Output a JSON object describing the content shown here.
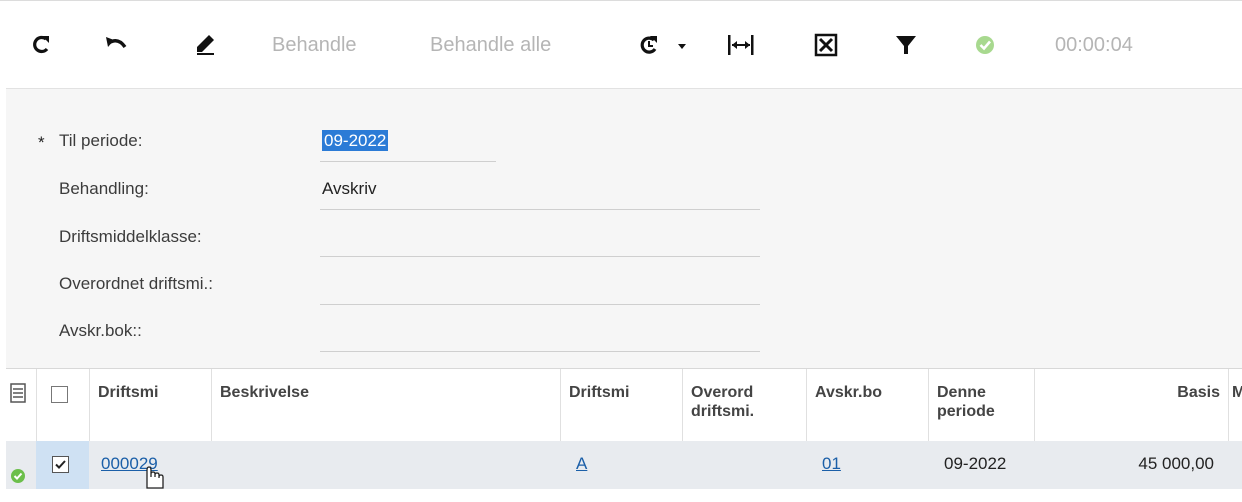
{
  "toolbar": {
    "refresh_icon": "refresh-icon",
    "undo_icon": "undo-icon",
    "edit_icon": "pencil-icon",
    "process_label": "Behandle",
    "process_all_label": "Behandle alle",
    "schedule_icon": "clock-refresh-icon",
    "fit_icon": "fit-columns-icon",
    "excel_icon": "excel-export-icon",
    "filter_icon": "filter-icon",
    "status_icon": "success-check-icon",
    "timer": "00:00:04"
  },
  "form": {
    "to_period_label": "Til periode:",
    "to_period_required": "*",
    "to_period_value": "09-2022",
    "processing_label": "Behandling:",
    "processing_value": "Avskriv",
    "asset_class_label": "Driftsmiddelklasse:",
    "asset_class_value": "",
    "parent_asset_label": "Overordnet driftsmi.:",
    "parent_asset_value": "",
    "depr_book_label": "Avskr.bok::",
    "depr_book_value": ""
  },
  "grid": {
    "columns": [
      "Driftsmi",
      "Beskrivelse",
      "Driftsmi",
      "Overord driftsmi.",
      "Avskr.bo",
      "Denne periode",
      "Basis",
      "M"
    ],
    "rows": [
      {
        "status_icon": "success-check-icon",
        "selected": true,
        "asset": "000029",
        "description": "",
        "asset_class": "A",
        "parent": "",
        "book": "01",
        "period": "09-2022",
        "basis": "45 000,00"
      }
    ]
  },
  "colors": {
    "accent": "#1b5fa8",
    "success": "#6cbf4b",
    "selection": "#2b7bd6"
  }
}
